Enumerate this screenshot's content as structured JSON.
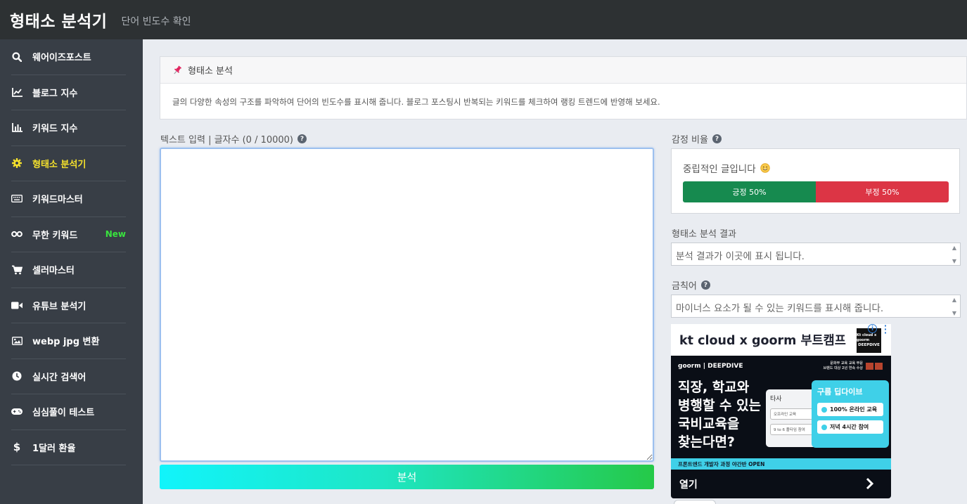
{
  "header": {
    "title": "형태소 분석기",
    "subtitle": "단어 빈도수 확인"
  },
  "sidebar": {
    "items": [
      {
        "label": "웨어이즈포스트",
        "icon": "search-icon",
        "active": false
      },
      {
        "label": "블로그 지수",
        "icon": "line-chart-icon",
        "active": false
      },
      {
        "label": "키워드 지수",
        "icon": "bar-chart-icon",
        "active": false
      },
      {
        "label": "형태소 분석기",
        "icon": "gear-icon",
        "active": true
      },
      {
        "label": "키워드마스터",
        "icon": "keyboard-icon",
        "active": false
      },
      {
        "label": "무한 키워드",
        "icon": "infinity-icon",
        "active": false,
        "badge": "New"
      },
      {
        "label": "셀러마스터",
        "icon": "cart-icon",
        "active": false
      },
      {
        "label": "유튜브 분석기",
        "icon": "video-camera-icon",
        "active": false
      },
      {
        "label": "webp jpg 변환",
        "icon": "image-icon",
        "active": false
      },
      {
        "label": "실시간 검색어",
        "icon": "clock-icon",
        "active": false
      },
      {
        "label": "심심풀이 테스트",
        "icon": "gamepad-icon",
        "active": false
      },
      {
        "label": "1달러 환율",
        "icon": "dollar-icon",
        "active": false
      }
    ],
    "active_color": "#f5e12c",
    "badge_color": "#39e33e"
  },
  "info_card": {
    "title": "형태소 분석",
    "description": "글의 다양한 속성의 구조를 파악하여 단어의 빈도수를 표시해 줍니다. 블로그 포스팅시 반복되는 키워드를 체크하여 랭킹 트렌드에 반영해 보세요."
  },
  "input": {
    "label": "텍스트 입력 | 글자수 (0 / 10000)",
    "value": "",
    "button": "분석"
  },
  "sentiment": {
    "label": "감정 비율",
    "message": "중립적인 글입니다",
    "positive_label": "긍정 50%",
    "negative_label": "부정 50%",
    "positive_ratio": 0.5,
    "negative_ratio": 0.5,
    "positive_color": "#168a4f",
    "negative_color": "#dc3545"
  },
  "result": {
    "label": "형태소 분석 결과",
    "placeholder": "분석 결과가 이곳에 표시 됩니다."
  },
  "forbidden": {
    "label": "금칙어",
    "placeholder": "마이너스 요소가 될 수 있는 키워드를 표시해 줍니다."
  },
  "ad": {
    "headline": "kt cloud x goorm 부트캠프",
    "logo_line1": "Kt cloud x goorm",
    "logo_line2": "DEEPDIVE",
    "brand": "goorm | DEEPDIVE",
    "award_line1": "문화부 교육 교육 부문",
    "award_line2": "브랜드 대상 2년 연속 수상",
    "body": "직장, 학교와\n병행할 수 있는\n국비교육을\n찾는다면?",
    "other_label": "타사",
    "other_opt1": "오프라인 교육",
    "other_opt2": "9 to 6 풀타임 참여",
    "ours_label": "구름 딥다이브",
    "ours_opt1": "100% 온라인 교육",
    "ours_opt2": "저녁 4시간 참여",
    "strip": "프론트엔드 개발자 과정 야간반 OPEN",
    "cta": "열기"
  }
}
